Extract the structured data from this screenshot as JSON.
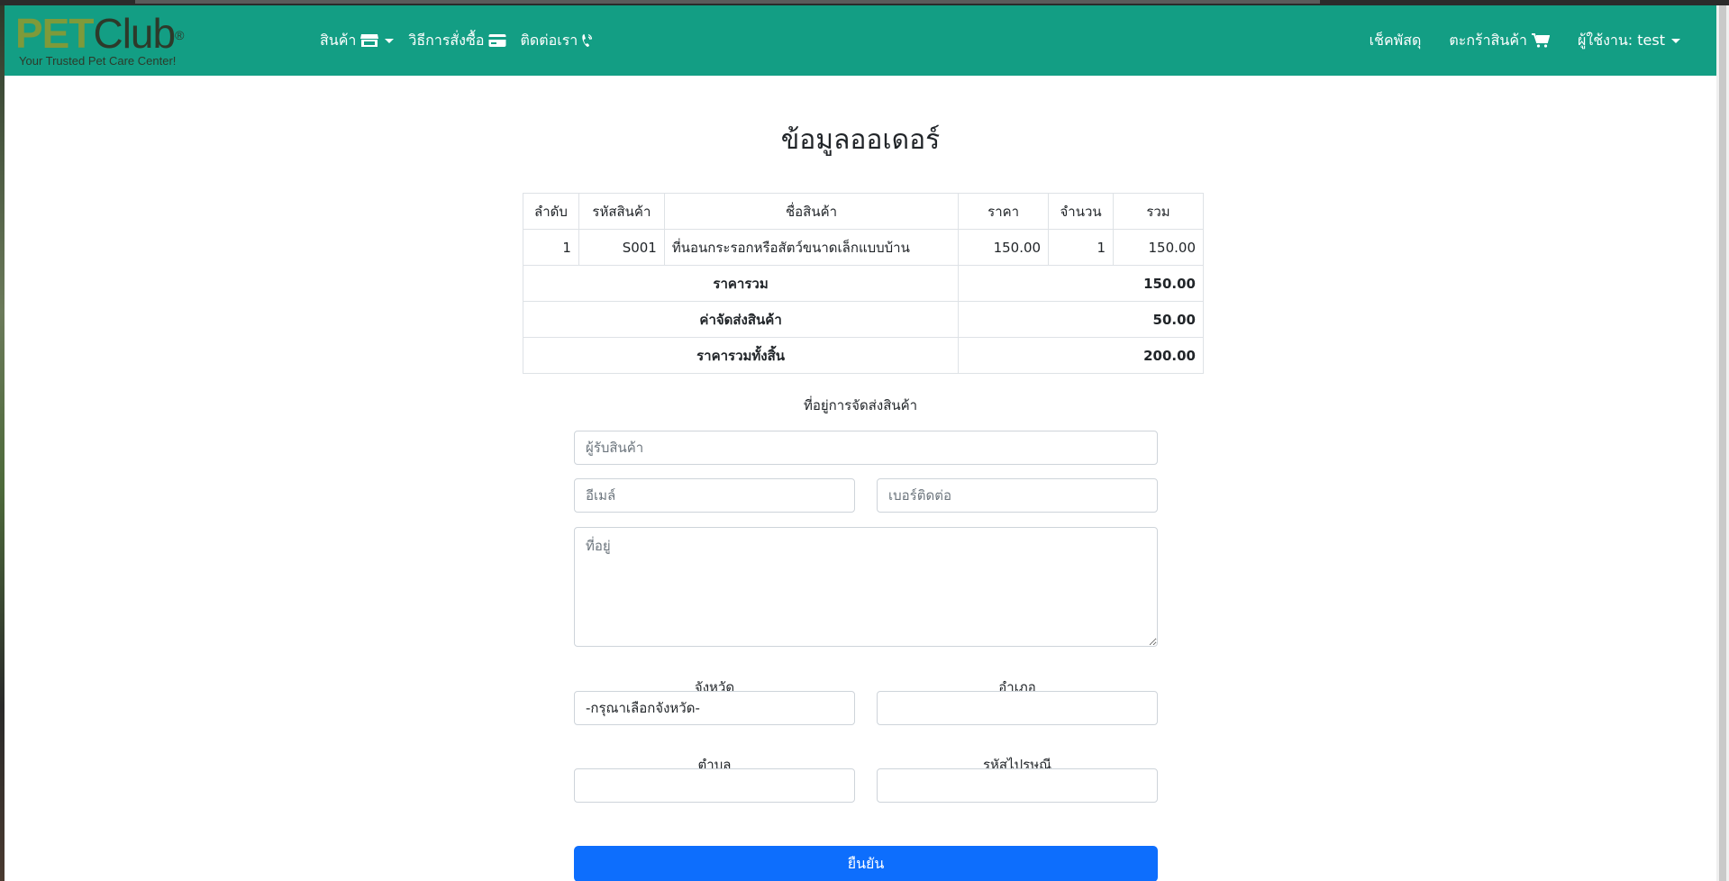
{
  "brand": {
    "logo_main_a": "PET",
    "logo_main_b": "Club",
    "logo_reg": "®",
    "tagline": "Your Trusted Pet Care Center!"
  },
  "nav": {
    "products": "สินค้า",
    "how_to_order": "วิธีการสั่งซื้อ",
    "contact": "ติดต่อเรา",
    "track": "เช็คพัสดุ",
    "cart": "ตะกร้าสินค้า",
    "user": "ผู้ใช้งาน: test"
  },
  "page": {
    "title": "ข้อมูลออเดอร์",
    "address_heading": "ที่อยู่การจัดส่งสินค้า"
  },
  "table": {
    "headers": [
      "ลำดับ",
      "รหัสสินค้า",
      "ชื่อสินค้า",
      "ราคา",
      "จำนวน",
      "รวม"
    ],
    "rows": [
      {
        "no": "1",
        "code": "S001",
        "name": "ที่นอนกระรอกหรือสัตว์ขนาดเล็กแบบบ้าน",
        "price": "150.00",
        "qty": "1",
        "total": "150.00"
      }
    ],
    "summary": [
      {
        "label": "ราคารวม",
        "value": "150.00"
      },
      {
        "label": "ค่าจัดส่งสินค้า",
        "value": "50.00"
      },
      {
        "label": "ราคารวมทั้งสิ้น",
        "value": "200.00"
      }
    ]
  },
  "form": {
    "receiver_placeholder": "ผู้รับสินค้า",
    "email_placeholder": "อีเมล์",
    "phone_placeholder": "เบอร์ติดต่อ",
    "address_placeholder": "ที่อยู่",
    "province_label": "จังหวัด",
    "province_value": "-กรุณาเลือกจังหวัด-",
    "district_label": "อำเภอ",
    "subdistrict_label": "ตำบล",
    "postcode_label": "รหัสไปรษณี",
    "submit": "ยืนยัน"
  },
  "colors": {
    "navbar": "#139e84",
    "primary_button": "#0d6efd"
  }
}
